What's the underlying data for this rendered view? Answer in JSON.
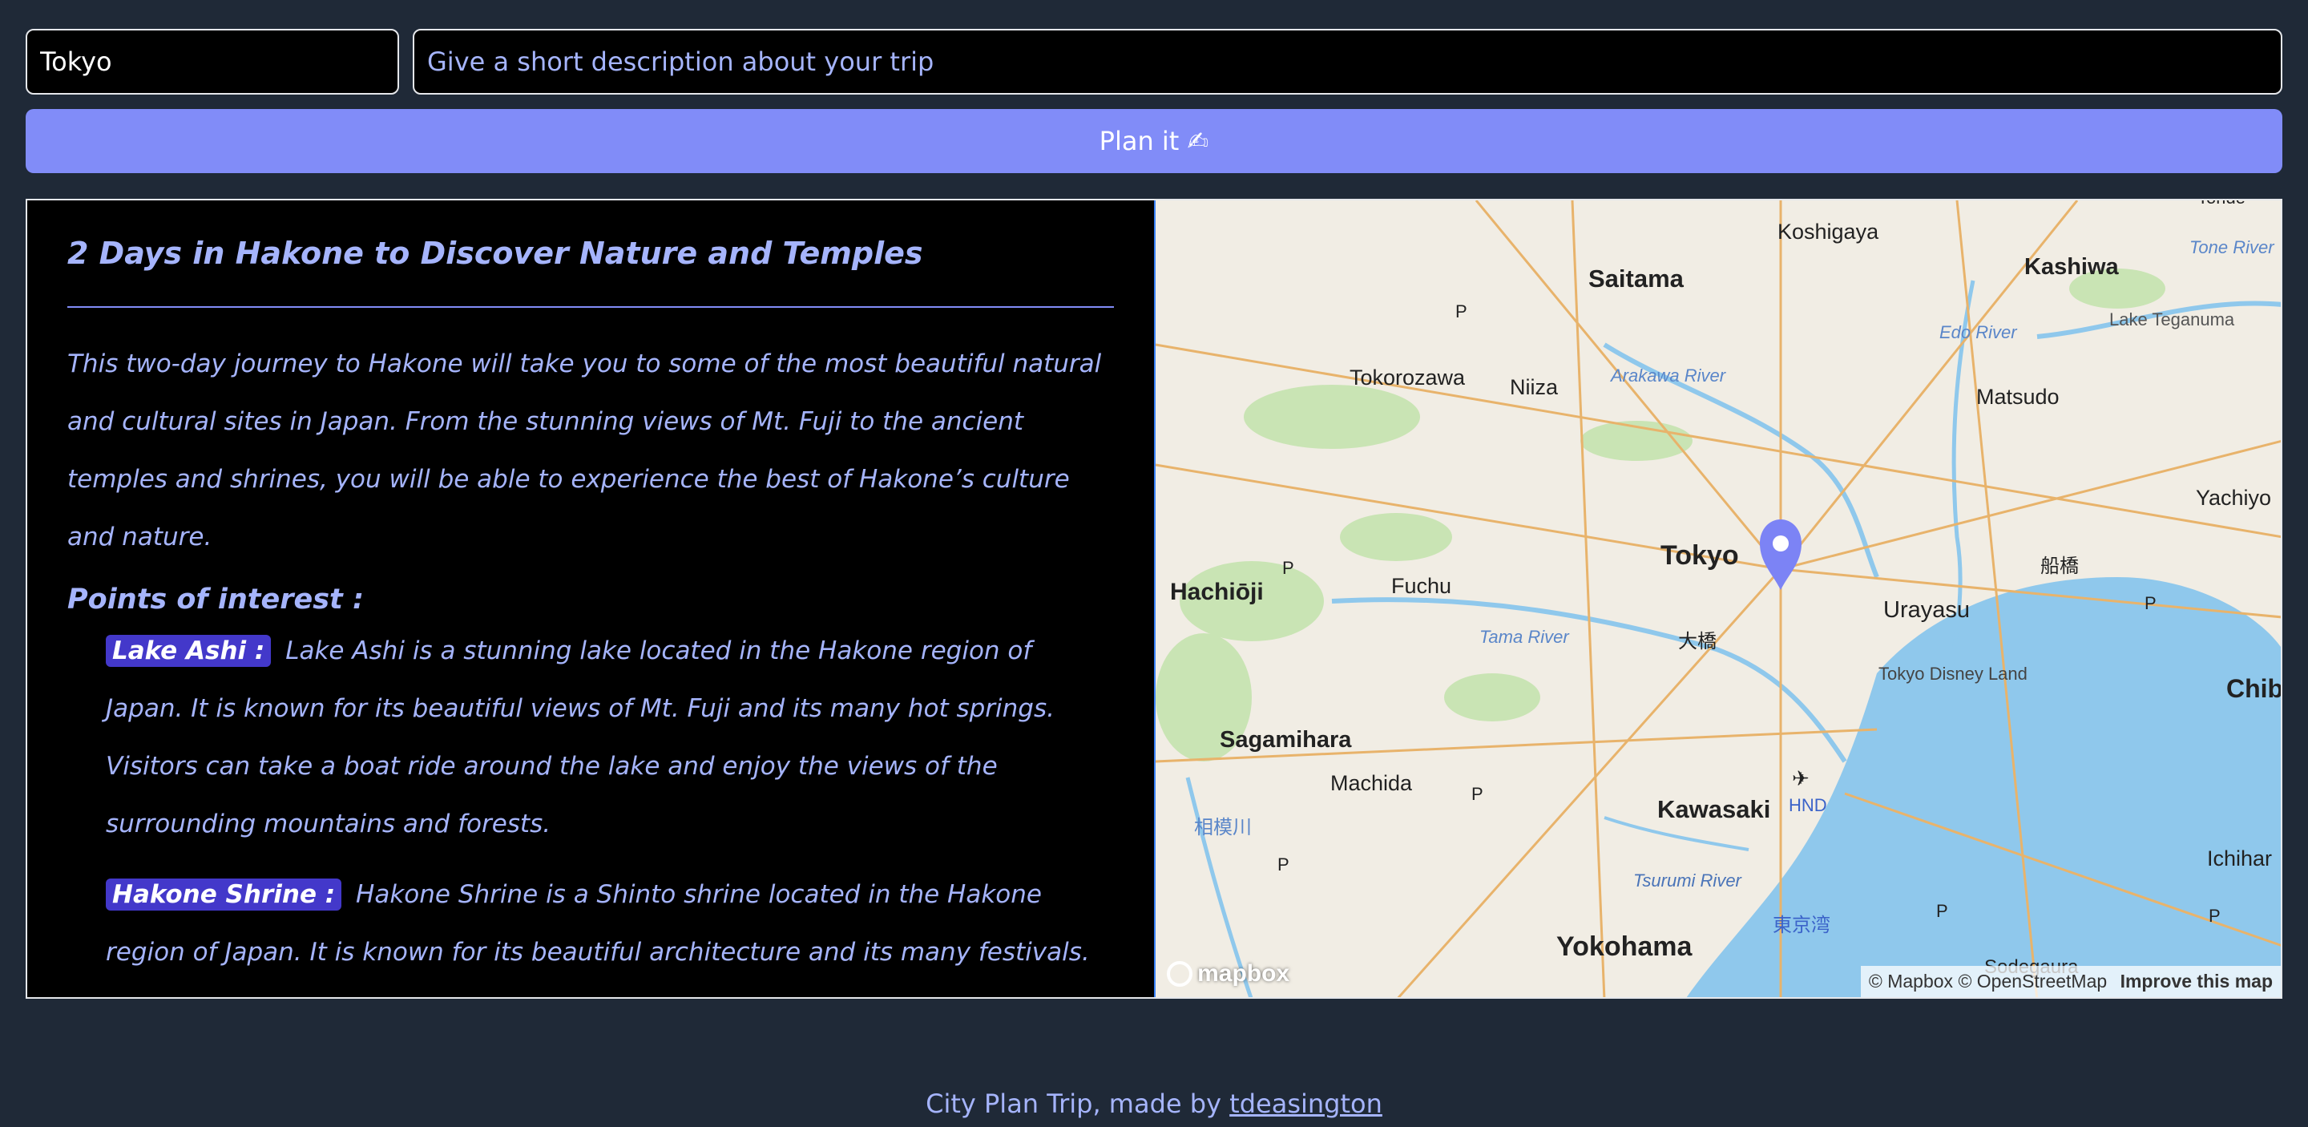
{
  "form": {
    "city_value": "Tokyo",
    "description_placeholder": "Give a short description about your trip",
    "plan_button_label": "Plan it ✍"
  },
  "trip": {
    "title": "2 Days in Hakone to Discover Nature and Temples",
    "description": "This two-day journey to Hakone will take you to some of the most beautiful natural and cultural sites in Japan. From the stunning views of Mt. Fuji to the ancient temples and shrines, you will be able to experience the best of Hakone’s culture and nature.",
    "points_heading": "Points of interest :",
    "points": [
      {
        "name": "Lake Ashi :",
        "text": "Lake Ashi is a stunning lake located in the Hakone region of Japan. It is known for its beautiful views of Mt. Fuji and its many hot springs. Visitors can take a boat ride around the lake and enjoy the views of the surrounding mountains and forests."
      },
      {
        "name": "Hakone Shrine :",
        "text": "Hakone Shrine is a Shinto shrine located in the Hakone region of Japan. It is known for its beautiful architecture and its many festivals. Visitors"
      }
    ]
  },
  "map": {
    "labels": {
      "koshigaya": "Koshigaya",
      "saitama": "Saitama",
      "kashiwa": "Kashiwa",
      "tone_river": "Tone River",
      "edo_river": "Edo River",
      "lake_teganuma": "Lake Teganuma",
      "tokorozawa": "Tokorozawa",
      "niiza": "Niiza",
      "arakawa_river": "Arakawa River",
      "matsudo": "Matsudo",
      "yachiyo": "Yachiyo",
      "tokyo": "Tokyo",
      "hachioji": "Hachiōji",
      "fuchu": "Fuchu",
      "funabashi": "船橋",
      "urayasu": "Urayasu",
      "tama_river": "Tama River",
      "ohashi": "大橋",
      "tokyo_disney_land": "Tokyo Disney Land",
      "chiba": "Chib",
      "sagamihara": "Sagamihara",
      "machida": "Machida",
      "hnd": "HND",
      "kawasaki": "Kawasaki",
      "sagamigawa": "相模川",
      "tsurumi_river": "Tsurumi River",
      "ichihara": "Ichihar",
      "tokyo_bay": "東京湾",
      "yokohama": "Yokohama",
      "sodegaura": "Sodegaura",
      "toride": "Toride",
      "parking": "P"
    },
    "logo_text": "mapbox",
    "attribution": {
      "mapbox": "© Mapbox",
      "osm": "© OpenStreetMap",
      "improve": "Improve this map"
    },
    "colors": {
      "land": "#f1ede4",
      "water": "#8fc8ec",
      "park": "#c9e4b4",
      "road": "#e8b36b",
      "marker": "#7c83f5"
    }
  },
  "footer": {
    "text": "City Plan Trip, made by ",
    "author": "tdeasington"
  },
  "colors": {
    "background": "#1f2937",
    "accent": "#818cf8",
    "text": "#a5b4fc",
    "badge": "#4338ca"
  }
}
